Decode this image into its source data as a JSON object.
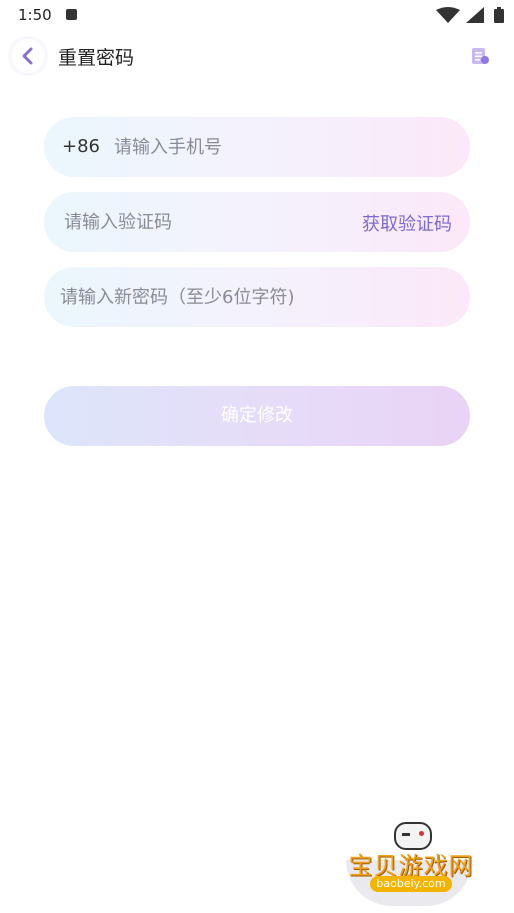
{
  "status_bar": {
    "time": "1:50",
    "icons": [
      "app-notification-icon",
      "wifi-icon",
      "signal-icon",
      "battery-icon"
    ]
  },
  "header": {
    "title": "重置密码",
    "back_icon": "chevron-left-icon",
    "action_icon": "document-icon"
  },
  "form": {
    "phone": {
      "country_code": "+86",
      "placeholder": "请输入手机号",
      "value": ""
    },
    "code": {
      "placeholder": "请输入验证码",
      "value": "",
      "get_code_label": "获取验证码"
    },
    "password": {
      "placeholder": "请输入新密码（至少6位字符)",
      "value": ""
    },
    "submit_label": "确定修改"
  },
  "watermark": {
    "title": "宝贝游戏网",
    "url": "baobeiy.com"
  },
  "colors": {
    "accent": "#7d6ad0",
    "field_gradient": [
      "#ebf6fd",
      "#f4f2fd",
      "#fce8f8"
    ],
    "button_gradient": [
      "#dde5fb",
      "#e6dcf8",
      "#ead3f6"
    ]
  }
}
